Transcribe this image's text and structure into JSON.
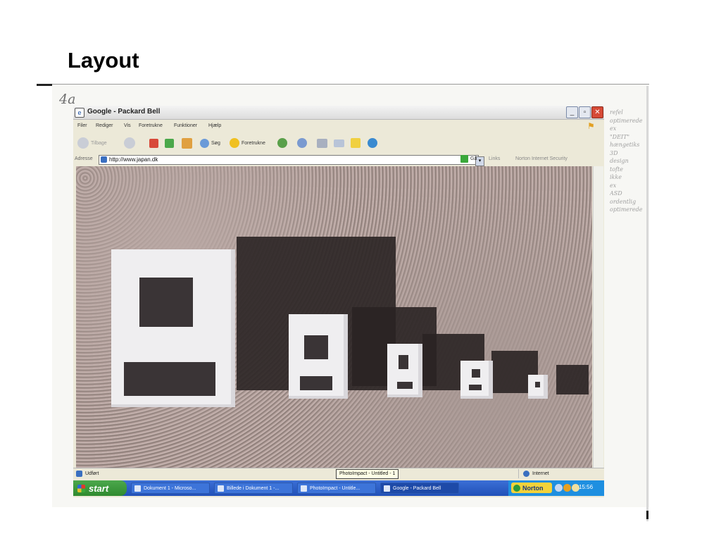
{
  "slide": {
    "title": "Layout",
    "handwritten_mark": "4a",
    "margin_notes": [
      "refel",
      "optimerede",
      "ex",
      "\"DEIT\"",
      "hængetiks",
      "3D",
      "design",
      "tofte",
      "ikke",
      "ex",
      "ASD",
      "ordentlig",
      "optimerede"
    ]
  },
  "window": {
    "title": "Google - Packard Bell",
    "menu": [
      "Filer",
      "Rediger",
      "Vis",
      "Foretrukne",
      "Funktioner",
      "Hjælp"
    ],
    "toolbar": {
      "back": "Tilbage",
      "search": "Søg",
      "favorites": "Foretrukne"
    },
    "address": {
      "label": "Adresse",
      "url": "http://www.japan.dk",
      "go": "Gå",
      "links": "Links",
      "norton": "Norton Internet Security"
    },
    "status": {
      "left": "Udført",
      "tooltip": "PhotoImpact - Untitled - 1",
      "zone": "Internet"
    }
  },
  "taskbar": {
    "start": "start",
    "tasks": [
      "Dokument 1 - Microso...",
      "Billede i Dokument 1 -...",
      "PhotoImpact - Untitle...",
      "Google - Packard Bell"
    ],
    "norton": "Norton",
    "clock": "15:56"
  },
  "colors": {
    "taskbar": "#2150b8",
    "start": "#2f8a2f",
    "close": "#d64a36",
    "norton": "#f3d23a"
  }
}
